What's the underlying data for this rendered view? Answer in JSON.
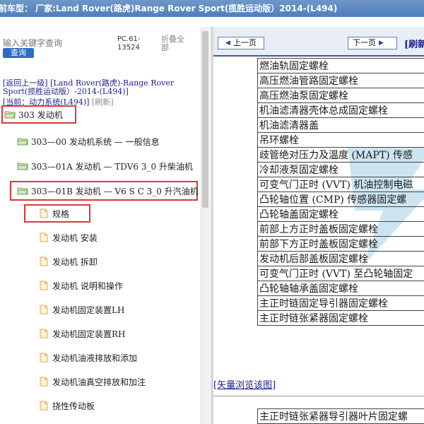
{
  "topbar": {
    "title": "前车型： 厂家:Land Rover(路虎)Range Rover Sport(揽胜运动版）2014-(L494)"
  },
  "sidebar": {
    "search_placeholder": "输入关键字查询",
    "search_button": "查询",
    "pc_code": "PC.61-13524",
    "collapse_all": "折叠全部",
    "nav_up_link": "[返回上一级]",
    "nav_up_text": "[Land Rover(路虎)-Range Rover Sport(揽胜运动版）-2014-(L494)]",
    "current_label": "[当前：动力系统(L494)]",
    "refresh_link": "[刷新]",
    "tree": [
      {
        "label": "303 发动机",
        "type": "folder"
      },
      {
        "label": "303—00 发动机系统 — 一般信息",
        "type": "folder"
      },
      {
        "label": "303—01A 发动机 — TDV6 3_0 升柴油机",
        "type": "folder"
      },
      {
        "label": "303—01B 发动机 — V6 S C 3_0 升汽油机",
        "type": "folder"
      },
      {
        "label": "规格",
        "type": "doc"
      },
      {
        "label": "发动机 安装",
        "type": "doc"
      },
      {
        "label": "发动机 拆卸",
        "type": "doc"
      },
      {
        "label": "发动机 说明和操作",
        "type": "doc"
      },
      {
        "label": "发动机固定装置LH",
        "type": "doc"
      },
      {
        "label": "发动机固定装置RH",
        "type": "doc"
      },
      {
        "label": "发动机油液排放和添加",
        "type": "doc"
      },
      {
        "label": "发动机油真空排放和加注",
        "type": "doc"
      },
      {
        "label": "挠性传动板",
        "type": "doc"
      }
    ]
  },
  "content": {
    "prev_button": "上一页",
    "next_button": "下一页",
    "refresh_label": "[刷新",
    "spec_rows": [
      "燃油轨固定螺栓",
      "高压燃油管路固定螺栓",
      "高压燃油泵固定螺栓",
      "机油滤清器壳体总成固定螺栓",
      "机油滤清器盖",
      "吊环螺栓",
      "歧管绝对压力及温度 (MAPT) 传感",
      "冷却液泵固定螺栓",
      "可变气门正时 (VVT) 机油控制电磁",
      "凸轮轴位置 (CMP) 传感器固定螺",
      "凸轮轴盖固定螺栓",
      "前部上方正时盖板固定螺栓",
      "前部下方正时盖板固定螺栓",
      "发动机后部盖板固定螺栓",
      "可变气门正时 (VVT) 至凸轮轴固定",
      "凸轮轴轴承盖固定螺栓",
      "主正时链固定导引器固定螺栓",
      "主正时链张紧器固定螺栓"
    ],
    "vector_link": "[矢量浏览该图]",
    "bottom_row": "主正时链张紧器导引器叶片固定螺"
  },
  "colors": {
    "topbar": "#5a87c2",
    "highlight_box": "#d63a3a",
    "link": "#1e1e8a",
    "button_blue": "#2c6cc7"
  }
}
